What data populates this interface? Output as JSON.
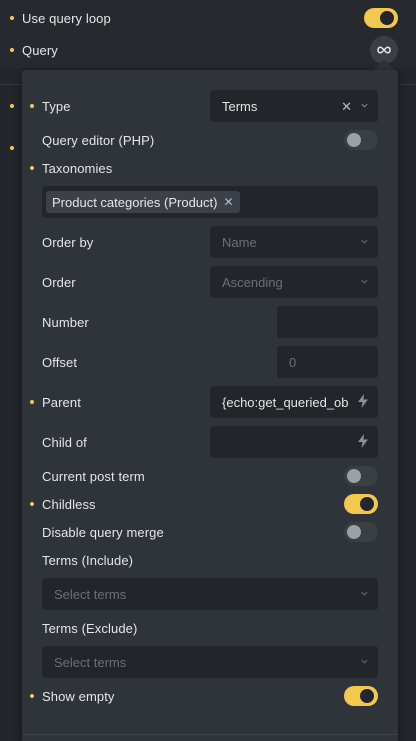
{
  "outer": {
    "use_query_loop_label": "Use query loop",
    "use_query_loop_on": true,
    "query_label": "Query",
    "query_icon": "infinity-icon"
  },
  "popup": {
    "type": {
      "label": "Type",
      "value": "Terms"
    },
    "query_editor": {
      "label": "Query editor (PHP)",
      "on": false
    },
    "taxonomies": {
      "label": "Taxonomies",
      "tags": [
        "Product categories (Product)"
      ]
    },
    "order_by": {
      "label": "Order by",
      "placeholder": "Name"
    },
    "order": {
      "label": "Order",
      "placeholder": "Ascending"
    },
    "number": {
      "label": "Number",
      "value": ""
    },
    "offset": {
      "label": "Offset",
      "placeholder": "0"
    },
    "parent": {
      "label": "Parent",
      "value": "{echo:get_queried_obj"
    },
    "child_of": {
      "label": "Child of",
      "value": ""
    },
    "current_post_term": {
      "label": "Current post term",
      "on": false
    },
    "childless": {
      "label": "Childless",
      "on": true
    },
    "disable_query_merge": {
      "label": "Disable query merge",
      "on": false
    },
    "terms_include": {
      "label": "Terms (Include)",
      "placeholder": "Select terms"
    },
    "terms_exclude": {
      "label": "Terms (Exclude)",
      "placeholder": "Select terms"
    },
    "show_empty": {
      "label": "Show empty",
      "on": true
    }
  },
  "colors": {
    "accent": "#f2c94c",
    "field_bg": "#222529",
    "panel_bg": "#2f333a"
  }
}
